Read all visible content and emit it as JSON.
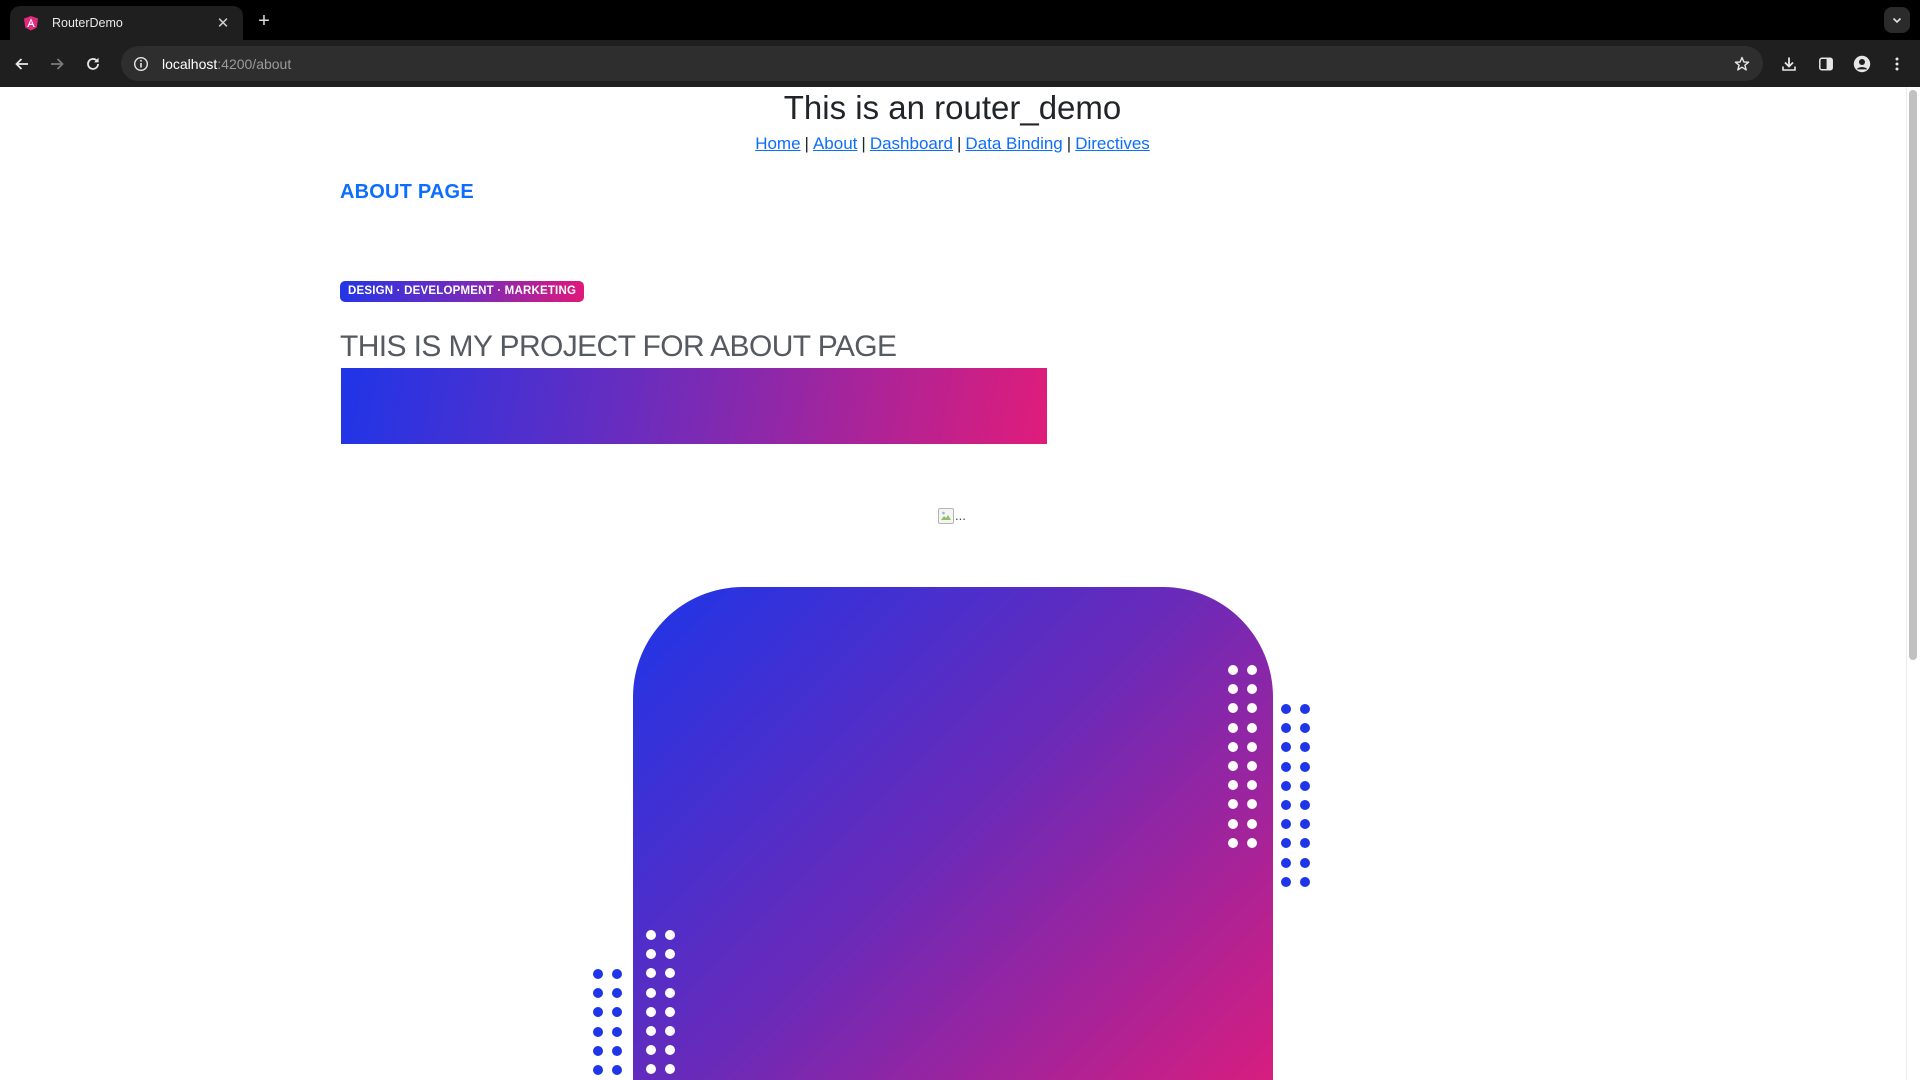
{
  "browser": {
    "tab_title": "RouterDemo",
    "url_host": "localhost",
    "url_path": ":4200/about",
    "icons": {
      "favicon": "angular-logo-icon",
      "close_tab": "close-icon",
      "new_tab": "plus-icon",
      "tab_search": "chevron-down-icon",
      "back": "arrow-left-icon",
      "forward": "arrow-right-icon",
      "reload": "reload-icon",
      "site_info": "info-icon",
      "bookmark": "star-icon",
      "download": "download-icon",
      "side_panel": "side-panel-icon",
      "profile": "profile-icon",
      "menu": "kebab-menu-icon"
    }
  },
  "page": {
    "title": "This is an router_demo",
    "nav": [
      {
        "label": "Home"
      },
      {
        "label": "About"
      },
      {
        "label": "Dashboard"
      },
      {
        "label": "Data Binding"
      },
      {
        "label": "Directives"
      }
    ],
    "nav_separator": "|",
    "about_heading": "ABOUT PAGE",
    "badge": "DESIGN · DEVELOPMENT · MARKETING",
    "project_heading": "THIS IS MY PROJECT FOR ABOUT PAGE",
    "image_alt": "..."
  },
  "colors": {
    "link": "#0d6efd",
    "gradient_start": "#1f35e8",
    "gradient_mid": "#7d2ab3",
    "gradient_end": "#e01c7a",
    "chrome_dark": "#1f1f1f"
  }
}
